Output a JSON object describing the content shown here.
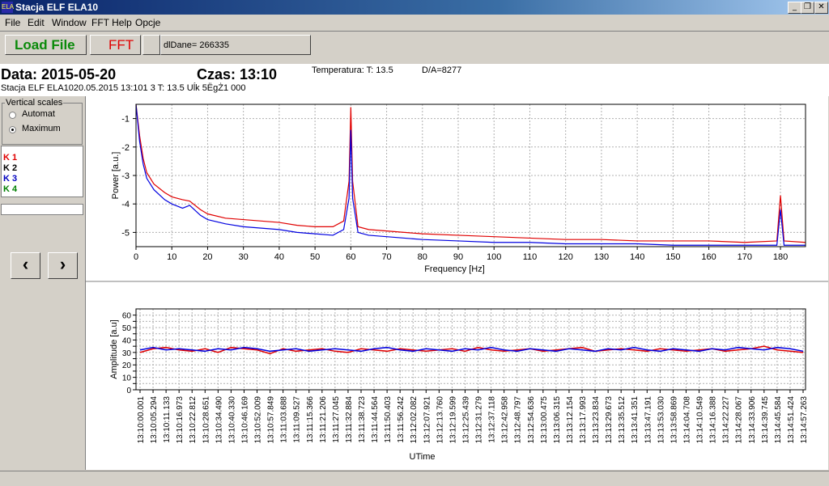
{
  "window": {
    "title": "Stacja ELF ELA10",
    "icon_label": "ELA"
  },
  "window_controls": {
    "minimize": "_",
    "maximize": "❐",
    "close": "✕"
  },
  "menu": [
    "File",
    "Edit",
    "Window",
    "FFT Help",
    "Opcje"
  ],
  "toolbar": {
    "load_label": "Load File",
    "fft_label": "FFT",
    "dldane": "dlDane= 266335"
  },
  "info": {
    "date_label": "Data: 2015-05-20",
    "time_label": "Czas: 13:10",
    "temp_label": "Temperatura: T: 13.5",
    "da_label": "D/A=8277",
    "station_line": "Stacja ELF ELA1020.05.2015 13:101 3 T: 13.5 Uĺk  5ËgŻ1 000"
  },
  "scales": {
    "group_label": "Vertical scales",
    "automat": "Automat",
    "maximum": "Maximum",
    "selected": "Maximum"
  },
  "channels": [
    {
      "label": "K 1",
      "color": "#e00000"
    },
    {
      "label": "K 2",
      "color": "#000000"
    },
    {
      "label": "K 3",
      "color": "#0000c0"
    },
    {
      "label": "K 4",
      "color": "#008000"
    }
  ],
  "nav": {
    "prev": "‹",
    "next": "›"
  },
  "chart_data": [
    {
      "type": "line",
      "xlabel": "Frequency [Hz]",
      "ylabel": "Power [a.u.]",
      "xlim": [
        0,
        187
      ],
      "ylim": [
        -5.5,
        -0.5
      ],
      "xticks": [
        0,
        10,
        20,
        30,
        40,
        50,
        60,
        70,
        80,
        90,
        100,
        110,
        120,
        130,
        140,
        150,
        160,
        170,
        180
      ],
      "yticks": [
        -1,
        -2,
        -3,
        -4,
        -5
      ],
      "grid": true,
      "series": [
        {
          "color": "#e00000",
          "x": [
            0,
            1,
            2,
            3,
            5,
            8,
            10,
            13,
            15,
            18,
            20,
            25,
            30,
            35,
            40,
            45,
            50,
            55,
            58,
            59.5,
            60,
            60.5,
            62,
            65,
            70,
            80,
            90,
            100,
            110,
            120,
            130,
            140,
            150,
            160,
            170,
            179,
            180,
            181,
            187
          ],
          "y": [
            -0.5,
            -1.6,
            -2.4,
            -2.9,
            -3.3,
            -3.6,
            -3.75,
            -3.85,
            -3.9,
            -4.2,
            -4.35,
            -4.5,
            -4.55,
            -4.6,
            -4.65,
            -4.75,
            -4.8,
            -4.8,
            -4.6,
            -3.2,
            -0.6,
            -3.2,
            -4.8,
            -4.9,
            -4.95,
            -5.05,
            -5.1,
            -5.15,
            -5.2,
            -5.25,
            -5.25,
            -5.3,
            -5.3,
            -5.3,
            -5.35,
            -5.3,
            -3.7,
            -5.3,
            -5.35
          ]
        },
        {
          "color": "#0000e0",
          "x": [
            0,
            1,
            2,
            3,
            5,
            8,
            10,
            13,
            15,
            18,
            20,
            25,
            30,
            35,
            40,
            45,
            50,
            55,
            58,
            59.5,
            60,
            60.5,
            62,
            65,
            70,
            80,
            90,
            100,
            110,
            120,
            130,
            140,
            150,
            160,
            170,
            179,
            180,
            181,
            187
          ],
          "y": [
            -0.5,
            -1.8,
            -2.6,
            -3.1,
            -3.5,
            -3.85,
            -4.0,
            -4.15,
            -4.05,
            -4.4,
            -4.55,
            -4.7,
            -4.8,
            -4.85,
            -4.9,
            -5.0,
            -5.05,
            -5.1,
            -4.9,
            -3.8,
            -1.4,
            -3.8,
            -5.0,
            -5.1,
            -5.15,
            -5.25,
            -5.3,
            -5.35,
            -5.35,
            -5.4,
            -5.4,
            -5.4,
            -5.45,
            -5.45,
            -5.45,
            -5.45,
            -4.2,
            -5.45,
            -5.45
          ]
        }
      ]
    },
    {
      "type": "line",
      "xlabel": "UTime",
      "ylabel": "Amplitude [a.u]",
      "ylim": [
        0,
        65
      ],
      "yticks": [
        0,
        5,
        10,
        15,
        20,
        25,
        30,
        35,
        40,
        45,
        50,
        55,
        60
      ],
      "grid": true,
      "categories": [
        "13:10:00.001",
        "13:10:05.294",
        "13:10:11.133",
        "13:10:16.973",
        "13:10:22.812",
        "13:10:28.651",
        "13:10:34.490",
        "13:10:40.330",
        "13:10:46.169",
        "13:10:52.009",
        "13:10:57.849",
        "13:11:03.688",
        "13:11:09.527",
        "13:11:15.366",
        "13:11:21.206",
        "13:11:27.045",
        "13:11:32.884",
        "13:11:38.723",
        "13:11:44.564",
        "13:11:50.403",
        "13:11:56.242",
        "13:12:02.082",
        "13:12:07.921",
        "13:12:13.760",
        "13:12:19.599",
        "13:12:25.439",
        "13:12:31.279",
        "13:12:37.118",
        "13:12:42.958",
        "13:12:48.797",
        "13:12:54.636",
        "13:13:00.475",
        "13:13:06.315",
        "13:13:12.154",
        "13:13:17.993",
        "13:13:23.834",
        "13:13:29.673",
        "13:13:35.512",
        "13:13:41.351",
        "13:13:47.191",
        "13:13:53.030",
        "13:13:58.869",
        "13:14:04.708",
        "13:14:10.549",
        "13:14:16.388",
        "13:14:22.227",
        "13:14:28.067",
        "13:14:33.906",
        "13:14:39.745",
        "13:14:45.584",
        "13:14:51.424",
        "13:14:57.263"
      ],
      "series": [
        {
          "color": "#e00000",
          "values": [
            30,
            33,
            34,
            32,
            31,
            33,
            30,
            34,
            33,
            32,
            29,
            33,
            31,
            32,
            33,
            31,
            30,
            33,
            32,
            31,
            33,
            32,
            31,
            32,
            33,
            31,
            34,
            32,
            31,
            32,
            33,
            31,
            32,
            33,
            34,
            31,
            32,
            33,
            32,
            31,
            33,
            32,
            31,
            32,
            33,
            31,
            32,
            33,
            35,
            32,
            31,
            30
          ]
        },
        {
          "color": "#0000e0",
          "values": [
            32,
            34,
            32,
            33,
            32,
            31,
            33,
            32,
            34,
            33,
            31,
            32,
            33,
            31,
            32,
            33,
            32,
            31,
            33,
            34,
            32,
            31,
            33,
            32,
            31,
            33,
            32,
            34,
            32,
            31,
            33,
            32,
            31,
            33,
            32,
            31,
            33,
            32,
            34,
            32,
            31,
            33,
            32,
            31,
            33,
            32,
            34,
            33,
            32,
            34,
            33,
            31
          ]
        }
      ]
    }
  ]
}
